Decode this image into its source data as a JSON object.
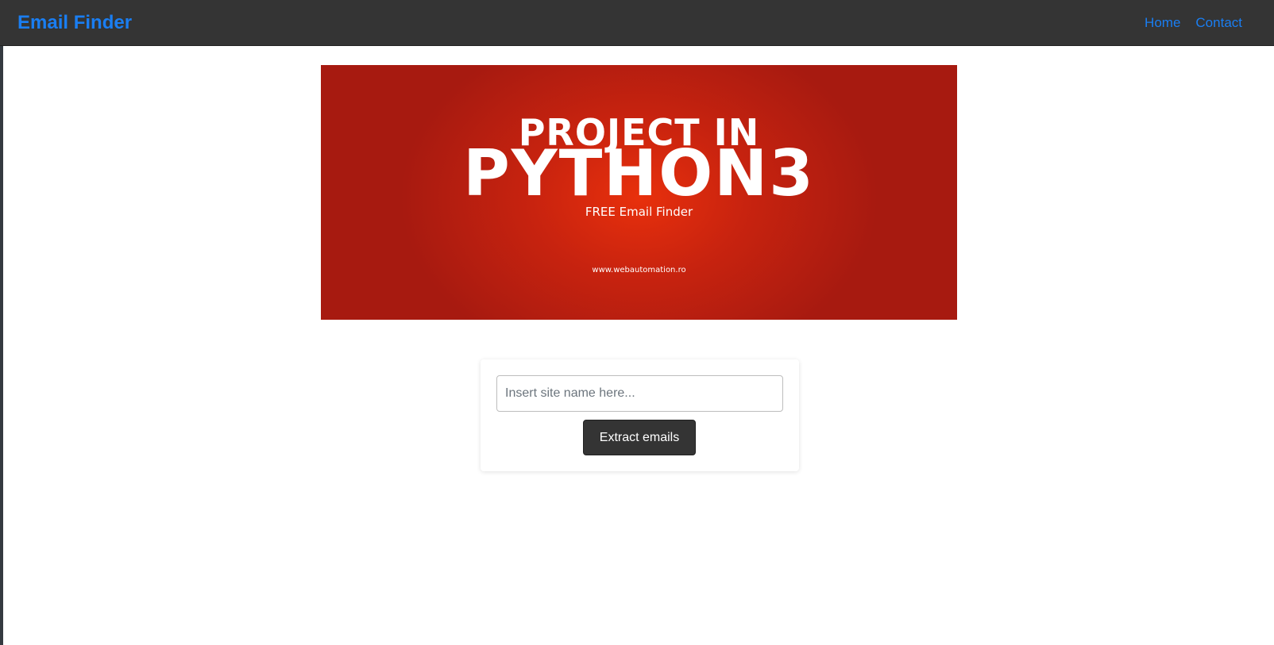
{
  "navbar": {
    "brand": "Email Finder",
    "links": [
      "Home",
      "Contact"
    ]
  },
  "banner": {
    "line1": "PROJECT IN",
    "line2": "PYTHON3",
    "subtitle": "FREE Email Finder",
    "url": "www.webautomation.ro"
  },
  "form": {
    "input_placeholder": "Insert site name here...",
    "input_value": "",
    "button_label": "Extract emails"
  },
  "colors": {
    "navbar_bg": "#343434",
    "link": "#1a7ef2",
    "banner_red": "#c8230f",
    "button_bg": "#343434"
  }
}
